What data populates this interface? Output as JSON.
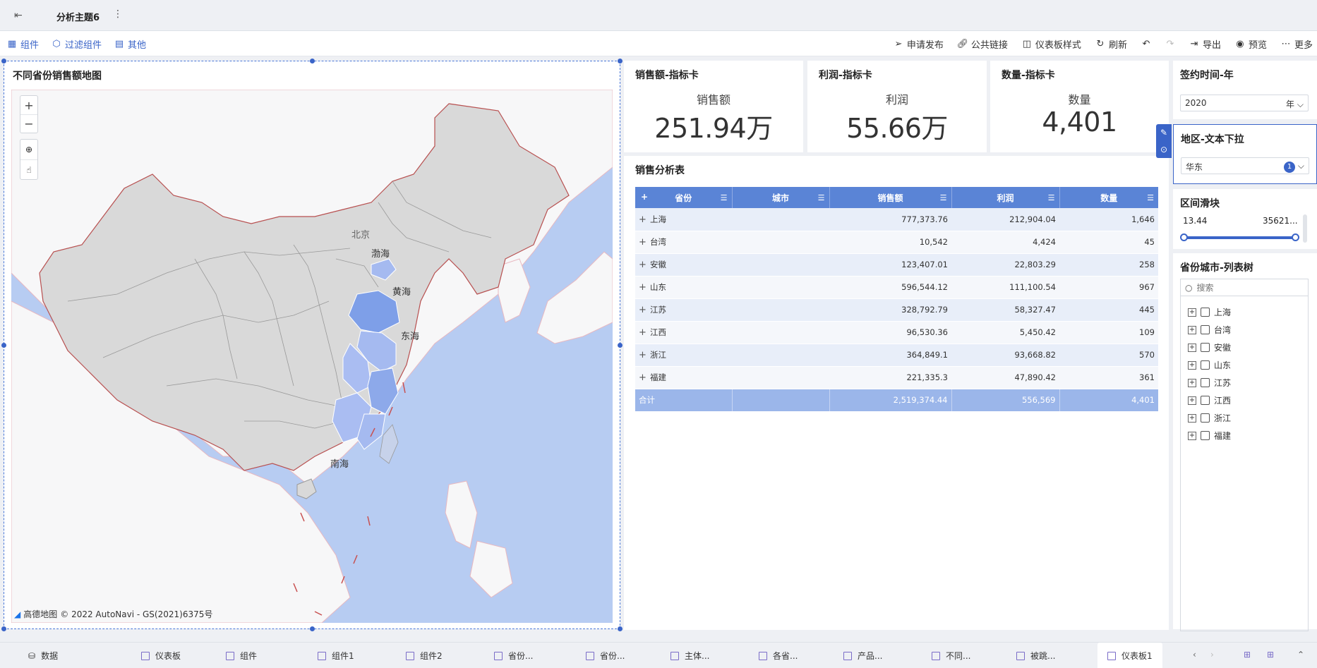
{
  "topbar": {
    "title": "分析主题6"
  },
  "toolbar": {
    "left": [
      "组件",
      "过滤组件",
      "其他"
    ],
    "right": [
      "申请发布",
      "公共链接",
      "仪表板样式",
      "刷新",
      "导出",
      "预览",
      "更多"
    ]
  },
  "map": {
    "title": "不同省份销售额地图",
    "labels": {
      "bohai": "渤海",
      "huanghai": "黄海",
      "donghai": "东海",
      "nanhai": "南海",
      "beijing": "北京"
    },
    "footer": "© 2022 AutoNavi - GS(2021)6375号",
    "footer_logo": "高德地图"
  },
  "kpis": [
    {
      "title": "销售额-指标卡",
      "label": "销售额",
      "value": "251.94万"
    },
    {
      "title": "利润-指标卡",
      "label": "利润",
      "value": "55.66万"
    },
    {
      "title": "数量-指标卡",
      "label": "数量",
      "value": "4,401"
    }
  ],
  "table": {
    "title": "销售分析表",
    "headers": [
      "省份",
      "城市",
      "销售额",
      "利润",
      "数量"
    ],
    "rows": [
      [
        "上海",
        "",
        "777,373.76",
        "212,904.04",
        "1,646"
      ],
      [
        "台湾",
        "",
        "10,542",
        "4,424",
        "45"
      ],
      [
        "安徽",
        "",
        "123,407.01",
        "22,803.29",
        "258"
      ],
      [
        "山东",
        "",
        "596,544.12",
        "111,100.54",
        "967"
      ],
      [
        "江苏",
        "",
        "328,792.79",
        "58,327.47",
        "445"
      ],
      [
        "江西",
        "",
        "96,530.36",
        "5,450.42",
        "109"
      ],
      [
        "浙江",
        "",
        "364,849.1",
        "93,668.82",
        "570"
      ],
      [
        "福建",
        "",
        "221,335.3",
        "47,890.42",
        "361"
      ]
    ],
    "total": [
      "合计",
      "",
      "2,519,374.44",
      "556,569",
      "4,401"
    ]
  },
  "filters": {
    "year": {
      "title": "签约时间-年",
      "value": "2020",
      "unit": "年"
    },
    "region": {
      "title": "地区-文本下拉",
      "value": "华东",
      "badge": "1"
    },
    "slider": {
      "title": "区间滑块",
      "min": "13.44",
      "max": "35621..."
    },
    "tree": {
      "title": "省份城市-列表树",
      "placeholder": "搜索",
      "items": [
        "上海",
        "台湾",
        "安徽",
        "山东",
        "江苏",
        "江西",
        "浙江",
        "福建"
      ]
    }
  },
  "bottom_tabs": [
    "数据",
    "仪表板",
    "组件",
    "组件1",
    "组件2",
    "省份...",
    "省份...",
    "主体...",
    "各省...",
    "产品...",
    "不同...",
    "被跳...",
    "仪表板1"
  ],
  "colors": {
    "accent": "#3a64c8",
    "header": "#5a84d6",
    "selected_region": "#7e9fe8",
    "ocean": "#b7ccf2",
    "land": "#d9d9d9"
  }
}
